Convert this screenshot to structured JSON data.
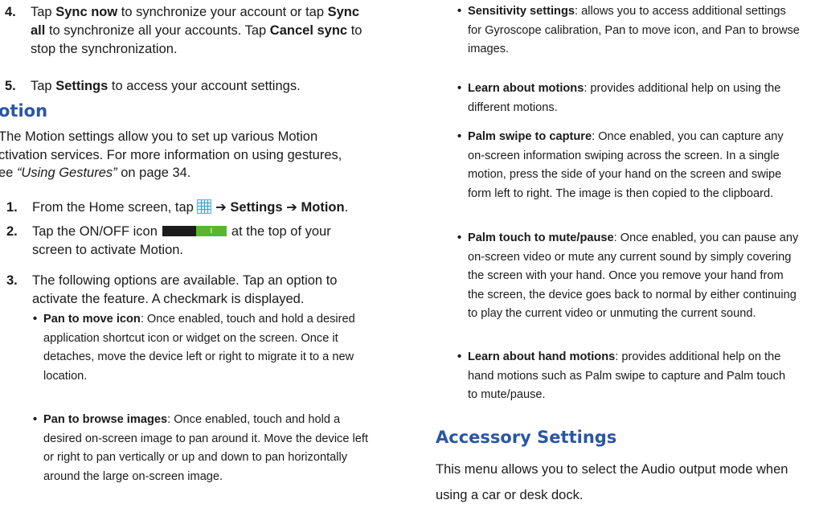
{
  "motion_section": {
    "step4_num": "4.",
    "step4": [
      "Tap ",
      "Sync now",
      " to synchronize your account or tap ",
      "Sync",
      "all",
      " to synchronize all your accounts. Tap ",
      "Cancel sync",
      " to",
      "stop the synchronization."
    ],
    "step5_num": "5.",
    "step5": [
      "Tap ",
      "Settings",
      " to access your account settings."
    ],
    "title": "otion",
    "intro_lines": [
      "The Motion settings allow you to set up various Motion",
      "ctivation services. For more information on using gestures,",
      "ee "
    ],
    "intro_ref": "“Using Gestures”",
    "intro_ref_tail": " on page 34.",
    "steps": [
      {
        "num": "1.",
        "pre": "From the Home screen, tap ",
        "icon": "apps-grid-icon",
        "arrow1": " ➔ ",
        "settings": "Settings",
        "arrow2": " ➔ ",
        "motion": "Motion",
        "end": "."
      },
      {
        "num": "2.",
        "pre": "Tap the ON/OFF icon",
        "toggle_label": "I",
        "post": "at the top of your",
        "line2": "screen to activate Motion."
      },
      {
        "num": "3.",
        "line1": "The following options are available. Tap an option to",
        "line2": "activate the feature. A checkmark is displayed."
      }
    ],
    "bullets": [
      {
        "title": "Pan to move icon",
        "lines": [
          ": Once enabled, touch and hold a desired",
          "application shortcut icon or widget on the screen. Once it",
          "detaches, move the device left or right to migrate it to a new",
          "location."
        ]
      },
      {
        "title": "Pan to browse images",
        "lines": [
          ": Once enabled, touch and hold a",
          "desired on-screen image to pan around it. Move the device left",
          "or right to pan vertically or up and down to pan horizontally",
          "around the large on-screen image."
        ]
      }
    ]
  },
  "right_column": {
    "bullets": [
      {
        "title": "Sensitivity settings",
        "lines": [
          ": allows you to access additional settings",
          "for Gyroscope calibration, Pan to move icon, and Pan to browse",
          "images."
        ]
      },
      {
        "title": "Learn about motions",
        "lines": [
          ": provides additional help on using the",
          "different motions."
        ]
      },
      {
        "title": "Palm swipe to capture",
        "lines": [
          ": Once enabled, you can capture any",
          "on-screen information swiping across the screen. In a single",
          "motion, press the side of your hand on the screen and swipe",
          "form left to right. The image is then copied to the clipboard."
        ]
      },
      {
        "title": "Palm touch to mute/pause",
        "lines": [
          ": Once enabled, you can pause any",
          "on-screen video or mute any current sound by simply covering",
          "the screen with your hand. Once you remove your hand from",
          "the screen, the device goes back to normal by either continuing",
          "to play the current video or unmuting the current sound."
        ]
      },
      {
        "title": "Learn about hand motions",
        "lines": [
          ": provides additional help on the",
          "hand motions such as Palm swipe to capture and Palm touch",
          "to mute/pause."
        ]
      }
    ],
    "accessory_title": "Accessory Settings",
    "accessory_lines": [
      "This menu allows you to select the Audio output mode when",
      "using a car or desk dock."
    ]
  },
  "colors": {
    "heading": "#2a55a5",
    "toggle_on": "#55b82e",
    "toggle_off": "#1c1c1c"
  }
}
